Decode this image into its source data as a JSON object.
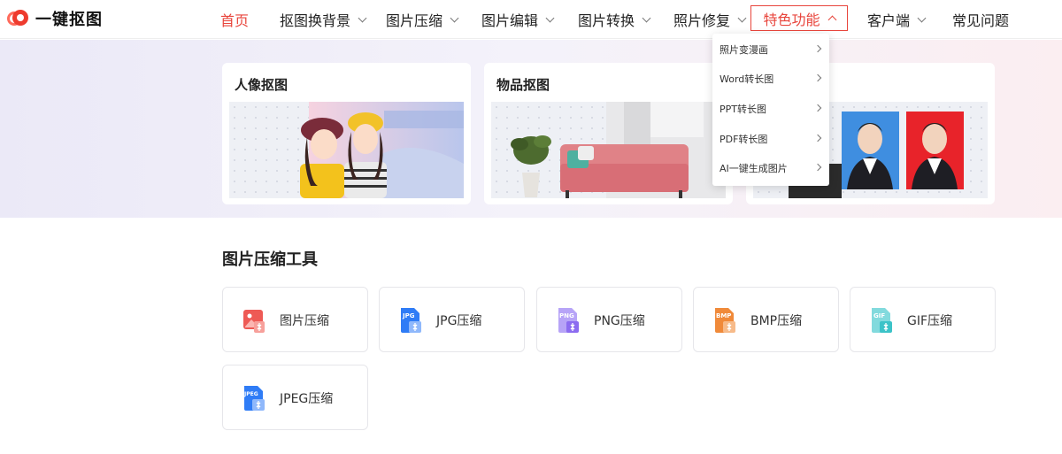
{
  "header": {
    "logo_text": "一键抠图",
    "nav": [
      {
        "label": "首页"
      },
      {
        "label": "抠图换背景"
      },
      {
        "label": "图片压缩"
      },
      {
        "label": "图片编辑"
      },
      {
        "label": "图片转换"
      },
      {
        "label": "照片修复"
      },
      {
        "label": "特色功能"
      },
      {
        "label": "客户端"
      },
      {
        "label": "常见问题"
      }
    ]
  },
  "dropdown": {
    "items": [
      {
        "label": "照片变漫画"
      },
      {
        "label": "Word转长图"
      },
      {
        "label": "PPT转长图"
      },
      {
        "label": "PDF转长图"
      },
      {
        "label": "AI一键生成图片"
      }
    ]
  },
  "cards": [
    {
      "title": "人像抠图"
    },
    {
      "title": "物品抠图"
    },
    {
      "title": ""
    }
  ],
  "tools_section": {
    "title": "图片压缩工具",
    "items": [
      {
        "label": "图片压缩",
        "icon": "image-compress-icon",
        "color": "#ee5a55",
        "badge": ""
      },
      {
        "label": "JPG压缩",
        "icon": "jpg-file-icon",
        "color": "#2f7cf6",
        "badge": "JPG"
      },
      {
        "label": "PNG压缩",
        "icon": "png-file-icon",
        "color": "#8c6cf0",
        "badge": "PNG"
      },
      {
        "label": "BMP压缩",
        "icon": "bmp-file-icon",
        "color": "#f08a3a",
        "badge": "BMP"
      },
      {
        "label": "GIF压缩",
        "icon": "gif-file-icon",
        "color": "#3cc3c8",
        "badge": "GIF"
      },
      {
        "label": "JPEG压缩",
        "icon": "jpeg-file-icon",
        "color": "#2f7cf6",
        "badge": "JPEG"
      }
    ]
  },
  "colors": {
    "accent": "#e8453c"
  }
}
